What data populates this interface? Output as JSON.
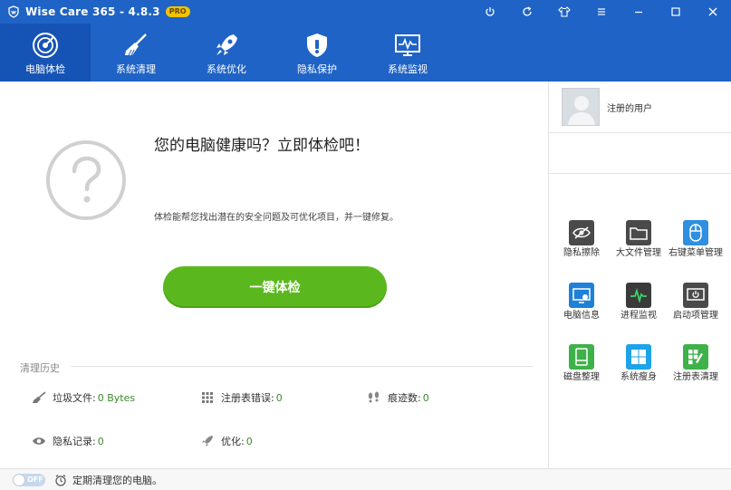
{
  "titlebar": {
    "title": "Wise Care 365 - 4.8.3",
    "badge": "PRO",
    "icons": [
      "power-icon",
      "refresh-icon",
      "shirt-icon",
      "menu-icon",
      "minimize-icon",
      "maximize-icon",
      "close-icon"
    ]
  },
  "nav": {
    "items": [
      {
        "label": "电脑体检",
        "icon": "radar-icon",
        "active": true
      },
      {
        "label": "系统清理",
        "icon": "broom-icon"
      },
      {
        "label": "系统优化",
        "icon": "rocket-icon"
      },
      {
        "label": "隐私保护",
        "icon": "shield-icon"
      },
      {
        "label": "系统监视",
        "icon": "monitor-icon"
      }
    ]
  },
  "main": {
    "headline": "您的电脑健康吗？立即体检吧！",
    "subtext": "体检能帮您找出潜在的安全问题及可优化项目，并一键修复。",
    "scan_button": "一键体检"
  },
  "history": {
    "title": "清理历史",
    "stats": [
      {
        "label": "垃圾文件:",
        "value": "0 Bytes",
        "icon": "broom-icon"
      },
      {
        "label": "注册表错误:",
        "value": "0",
        "icon": "grid-icon"
      },
      {
        "label": "痕迹数:",
        "value": "0",
        "icon": "footprint-icon"
      },
      {
        "label": "隐私记录:",
        "value": "0",
        "icon": "eye-icon"
      },
      {
        "label": "优化:",
        "value": "0",
        "icon": "rocket-icon"
      }
    ]
  },
  "user": {
    "name": "注册的用户"
  },
  "tools": [
    {
      "label": "隐私擦除",
      "icon": "privacy-eraser-icon",
      "color": "#4a4a4a"
    },
    {
      "label": "大文件管理",
      "icon": "folder-icon",
      "color": "#4a4a4a"
    },
    {
      "label": "右键菜单管理",
      "icon": "mouse-icon",
      "color": "#2f8fe0"
    },
    {
      "label": "电脑信息",
      "icon": "pc-info-icon",
      "color": "#1f80d8"
    },
    {
      "label": "进程监视",
      "icon": "pulse-icon",
      "color": "#3a3a3a"
    },
    {
      "label": "启动项管理",
      "icon": "startup-icon",
      "color": "#4a4a4a"
    },
    {
      "label": "磁盘整理",
      "icon": "disk-icon",
      "color": "#3fb14a"
    },
    {
      "label": "系统瘦身",
      "icon": "windows-icon",
      "color": "#1ea3e8"
    },
    {
      "label": "注册表清理",
      "icon": "registry-icon",
      "color": "#3fb14a"
    }
  ],
  "footer": {
    "toggle_text": "OFF",
    "text": "定期清理您的电脑。"
  },
  "colors": {
    "brand_blue": "#1f63c6",
    "scan_green": "#5ab81e"
  }
}
